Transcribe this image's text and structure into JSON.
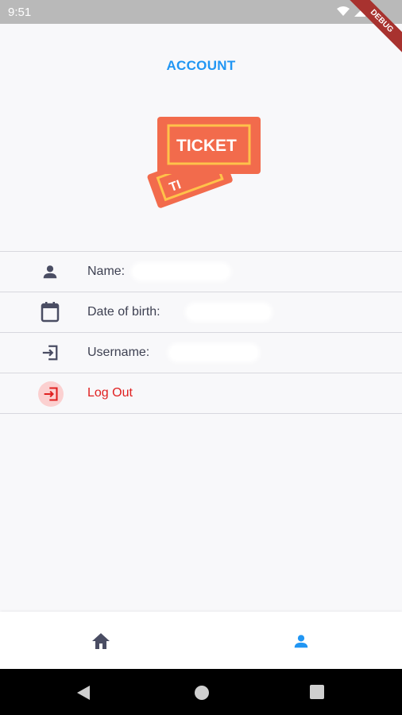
{
  "status_bar": {
    "time": "9:51",
    "debug_label": "DEBUG"
  },
  "header": {
    "title": "ACCOUNT"
  },
  "logo": {
    "text": "TICKET",
    "back_text": "TI"
  },
  "info_rows": [
    {
      "icon": "person-icon",
      "label": "Name:"
    },
    {
      "icon": "calendar-icon",
      "label": "Date of birth:"
    },
    {
      "icon": "login-icon",
      "label": "Username:"
    }
  ],
  "logout": {
    "label": "Log Out",
    "icon": "logout-icon"
  },
  "bottom_nav": [
    {
      "icon": "home-icon",
      "active": false
    },
    {
      "icon": "person-icon",
      "active": true
    }
  ],
  "colors": {
    "accent": "#2196f3",
    "logout_red": "#e02020",
    "logo_orange": "#f26b4c",
    "logo_yellow": "#ffc24a",
    "text": "#3e4152"
  }
}
